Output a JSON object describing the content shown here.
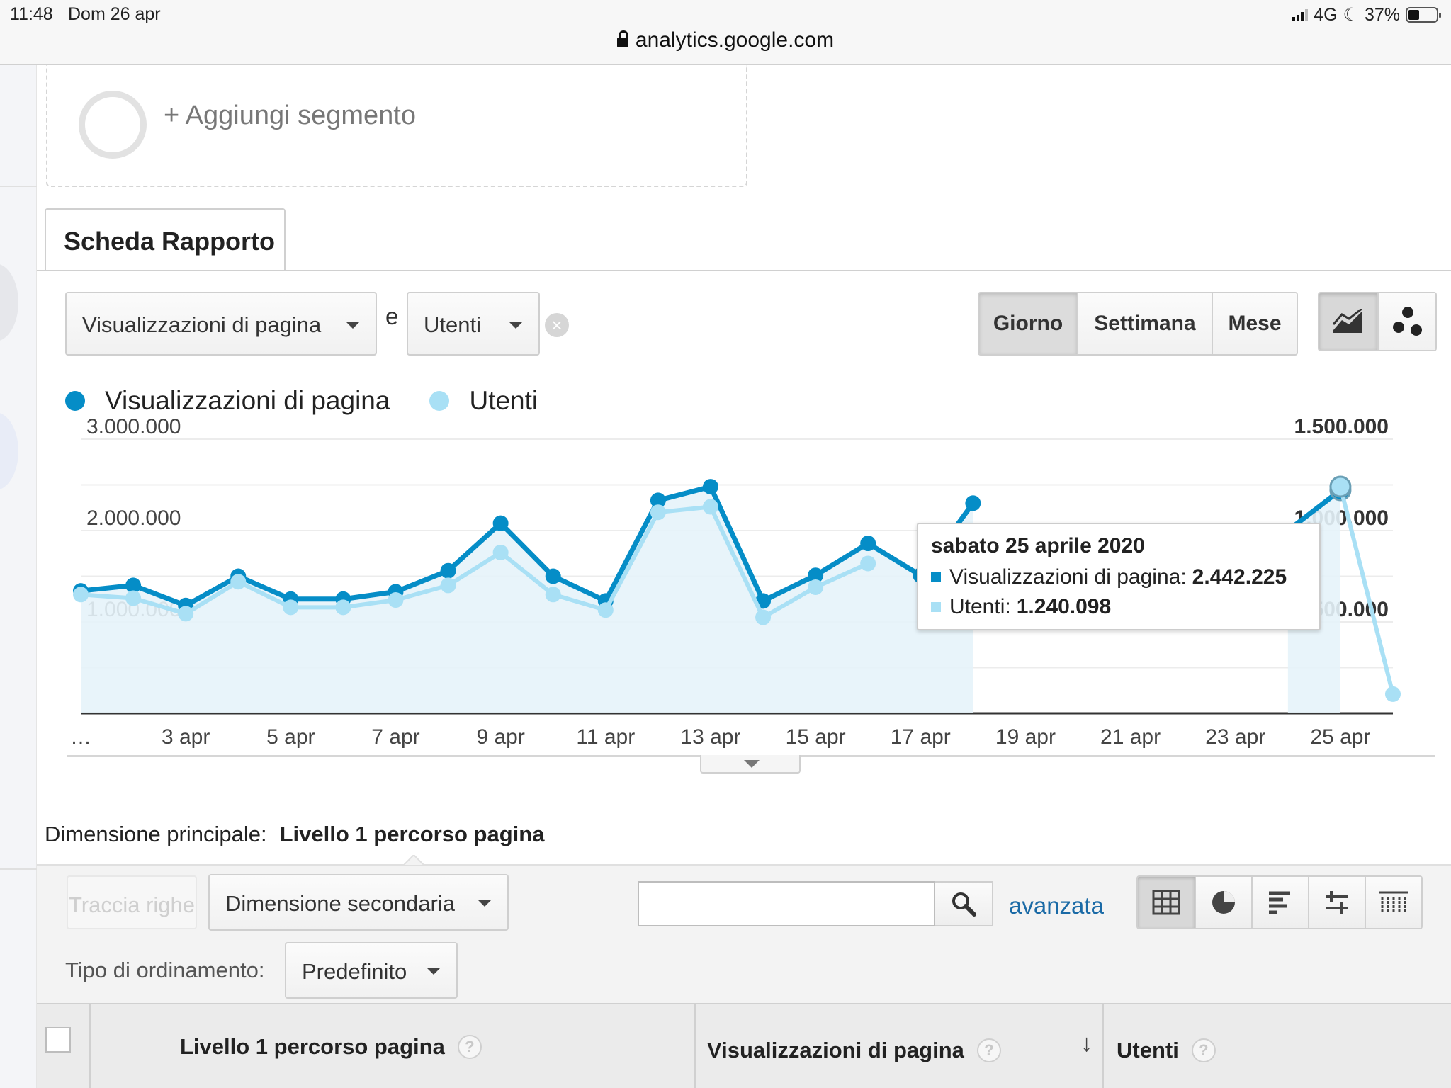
{
  "status_bar": {
    "time": "11:48",
    "date": "Dom 26 apr",
    "network": "4G",
    "battery": "37%",
    "url": "analytics.google.com"
  },
  "segment": {
    "add_label": "+ Aggiungi segmento"
  },
  "report_tab": {
    "label": "Scheda Rapporto"
  },
  "metrics": {
    "primary": "Visualizzazioni di pagina",
    "joiner": "e",
    "secondary": "Utenti"
  },
  "period_buttons": [
    "Giorno",
    "Settimana",
    "Mese"
  ],
  "active_period": "Giorno",
  "legend": [
    {
      "label": "Visualizzazioni di pagina",
      "color": "#058dc7"
    },
    {
      "label": "Utenti",
      "color": "#a9e0f5"
    }
  ],
  "tooltip": {
    "title": "sabato 25 aprile 2020",
    "rows": [
      {
        "label": "Visualizzazioni di pagina:",
        "value": "2.442.225",
        "color": "#058dc7"
      },
      {
        "label": "Utenti:",
        "value": "1.240.098",
        "color": "#a9e0f5"
      }
    ]
  },
  "chart_data": {
    "type": "line",
    "x": [
      "…",
      "2 apr",
      "3 apr",
      "4 apr",
      "5 apr",
      "6 apr",
      "7 apr",
      "8 apr",
      "9 apr",
      "10 apr",
      "11 apr",
      "12 apr",
      "13 apr",
      "14 apr",
      "15 apr",
      "16 apr",
      "17 apr",
      "18 apr",
      "19 apr",
      "20 apr",
      "21 apr",
      "22 apr",
      "23 apr",
      "24 apr",
      "25 apr",
      "26 apr"
    ],
    "x_tick_labels": [
      "…",
      "3 apr",
      "5 apr",
      "7 apr",
      "9 apr",
      "11 apr",
      "13 apr",
      "15 apr",
      "17 apr",
      "19 apr",
      "21 apr",
      "23 apr",
      "25 apr"
    ],
    "series": [
      {
        "name": "Visualizzazioni di pagina",
        "axis": "left",
        "values": [
          1340000,
          1400000,
          1180000,
          1500000,
          1250000,
          1250000,
          1330000,
          1560000,
          2080000,
          1500000,
          1230000,
          2330000,
          2480000,
          1230000,
          1510000,
          1860000,
          1510000,
          2300000,
          null,
          null,
          null,
          null,
          null,
          2000000,
          2442225,
          null
        ]
      },
      {
        "name": "Utenti",
        "axis": "right",
        "values": [
          650000,
          630000,
          545000,
          720000,
          580000,
          580000,
          620000,
          700000,
          880000,
          650000,
          565000,
          1100000,
          1130000,
          525000,
          690000,
          820000,
          null,
          null,
          null,
          null,
          null,
          null,
          null,
          null,
          1240098,
          105000
        ]
      }
    ],
    "y_left": {
      "ticks": [
        "3.000.000",
        "2.000.000",
        "1.000.000"
      ],
      "ylim": [
        0,
        3000000
      ]
    },
    "y_right": {
      "ticks": [
        "1.500.000",
        "1.000.000",
        "500.000"
      ],
      "ylim": [
        0,
        1500000
      ]
    },
    "colors": {
      "primary": "#058dc7",
      "secondary": "#a9e0f5",
      "area": "#e5f3fa"
    }
  },
  "dimension": {
    "label": "Dimensione principale:",
    "value": "Livello 1 percorso pagina"
  },
  "table_controls": {
    "plot_rows": "Traccia righe",
    "secondary_dimension": "Dimensione secondaria",
    "search_value": "",
    "advanced_link": "avanzata",
    "sort_label": "Tipo di ordinamento:",
    "sort_value": "Predefinito"
  },
  "table": {
    "columns": [
      "Livello 1 percorso pagina",
      "Visualizzazioni di pagina",
      "Utenti"
    ]
  }
}
